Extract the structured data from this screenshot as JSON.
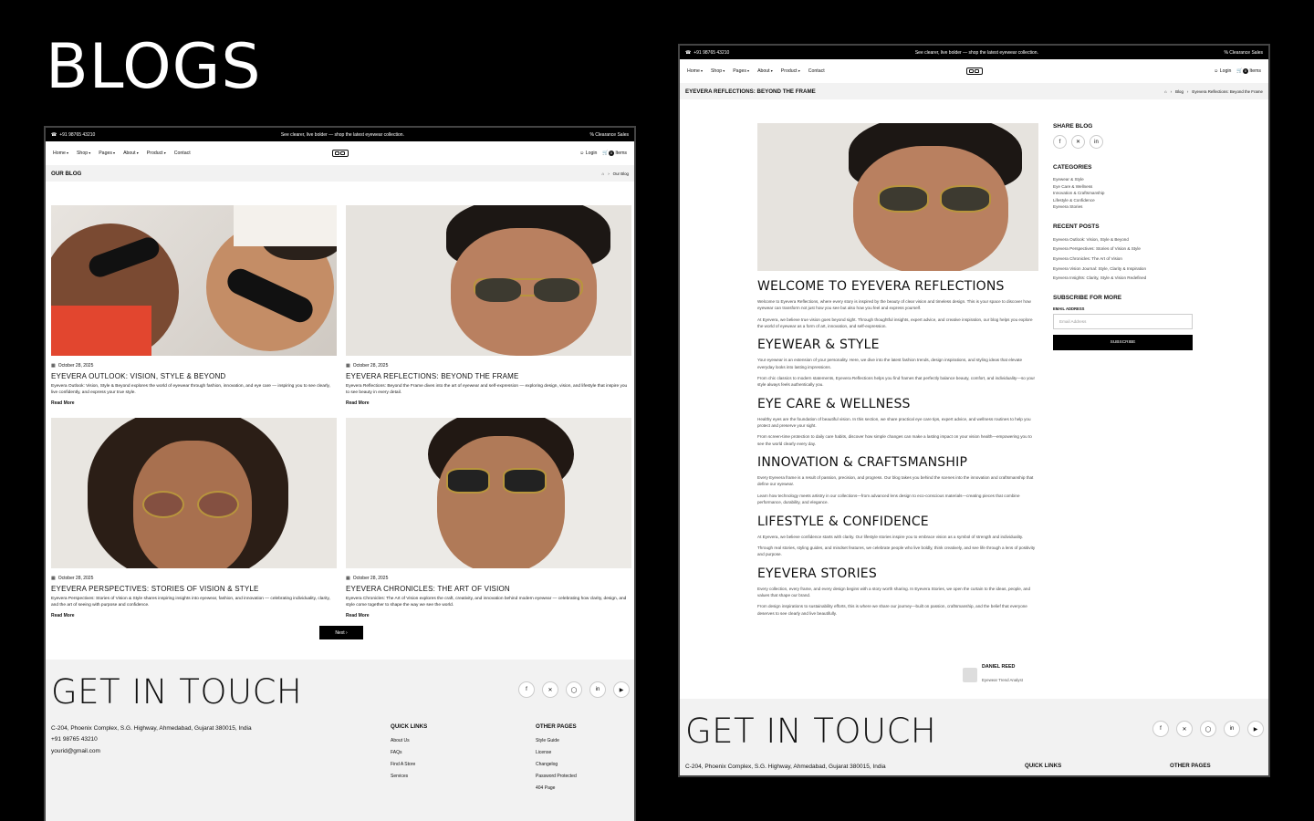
{
  "heading": "BLOGS",
  "topbar": {
    "phone": "+91 98765 43210",
    "promo": "See clearer, live bolder — shop the latest eyewear collection.",
    "sale": "Clearance Sales"
  },
  "nav": {
    "items": [
      "Home",
      "Shop",
      "Pages",
      "About",
      "Product",
      "Contact"
    ],
    "login": "Login",
    "cart_count": "0",
    "cart_label": "Items"
  },
  "blog_page": {
    "title": "OUR BLOG",
    "crumb": "Our Blog",
    "posts": [
      {
        "date": "October 28, 2025",
        "title": "EYEVERA OUTLOOK: VISION, STYLE & BEYOND",
        "excerpt": "Eyevera Outlook: Vision, Style & Beyond explores the world of eyewear through fashion, innovation, and eye care — inspiring you to see clearly, live confidently, and express your true style.",
        "read_more": "Read More"
      },
      {
        "date": "October 28, 2025",
        "title": "EYEVERA REFLECTIONS: BEYOND THE FRAME",
        "excerpt": "Eyevera Reflections: Beyond the Frame dives into the art of eyewear and self-expression — exploring design, vision, and lifestyle that inspire you to see beauty in every detail.",
        "read_more": "Read More"
      },
      {
        "date": "October 28, 2025",
        "title": "EYEVERA PERSPECTIVES: STORIES OF VISION & STYLE",
        "excerpt": "Eyevera Perspectives: Stories of Vision & Style shares inspiring insights into eyewear, fashion, and innovation — celebrating individuality, clarity, and the art of seeing with purpose and confidence.",
        "read_more": "Read More"
      },
      {
        "date": "October 28, 2025",
        "title": "EYEVERA CHRONICLES: THE ART OF VISION",
        "excerpt": "Eyevera Chronicles: The Art of Vision explores the craft, creativity, and innovation behind modern eyewear — celebrating how clarity, design, and style come together to shape the way we see the world.",
        "read_more": "Read More"
      }
    ],
    "next": "Next"
  },
  "footer": {
    "heading": "GET IN TOUCH",
    "address": "C-204, Phoenix Complex, S.G. Highway, Ahmedabad, Gujarat 380015, India",
    "phone": "+91 98765 43210",
    "email": "yourid@gmail.com",
    "quick_links_title": "QUICK LINKS",
    "quick_links": [
      "About Us",
      "FAQs",
      "Find A Store",
      "Services"
    ],
    "other_pages_title": "OTHER PAGES",
    "other_pages": [
      "Style Guide",
      "License",
      "Changelog",
      "Password Protected",
      "404 Page"
    ]
  },
  "article_page": {
    "title": "EYEVERA REFLECTIONS: BEYOND THE FRAME",
    "crumb_blog": "Blog",
    "crumb_current": "Eyevera Reflections: Beyond the Frame",
    "sections": [
      {
        "h": "WELCOME TO EYEVERA REFLECTIONS",
        "p1": "Welcome to Eyevera Reflections, where every story is inspired by the beauty of clear vision and timeless design. This is your space to discover how eyewear can transform not just how you see but also how you feel and express yourself.",
        "p2": "At Eyevera, we believe true vision goes beyond sight. Through thoughtful insights, expert advice, and creative inspiration, our blog helps you explore the world of eyewear as a form of art, innovation, and self-expression."
      },
      {
        "h": "EYEWEAR & STYLE",
        "p1": "Your eyewear is an extension of your personality. Here, we dive into the latest fashion trends, design inspirations, and styling ideas that elevate everyday looks into lasting impressions.",
        "p2": "From chic classics to modern statements, Eyevera Reflections helps you find frames that perfectly balance beauty, comfort, and individuality—so your style always feels authentically you."
      },
      {
        "h": "EYE CARE & WELLNESS",
        "p1": "Healthy eyes are the foundation of beautiful vision. In this section, we share practical eye care tips, expert advice, and wellness routines to help you protect and preserve your sight.",
        "p2": "From screen-time protection to daily care habits, discover how simple changes can make a lasting impact on your vision health—empowering you to see the world clearly every day."
      },
      {
        "h": "INNOVATION & CRAFTSMANSHIP",
        "p1": "Every Eyevera frame is a result of passion, precision, and progress. Our blog takes you behind the scenes into the innovation and craftsmanship that define our eyewear.",
        "p2": "Learn how technology meets artistry in our collections—from advanced lens design to eco-conscious materials—creating pieces that combine performance, durability, and elegance."
      },
      {
        "h": "LIFESTYLE & CONFIDENCE",
        "p1": "At Eyevera, we believe confidence starts with clarity. Our lifestyle stories inspire you to embrace vision as a symbol of strength and individuality.",
        "p2": "Through real stories, styling guides, and mindset features, we celebrate people who live boldly, think creatively, and see life through a lens of positivity and purpose."
      },
      {
        "h": "EYEVERA STORIES",
        "p1": "Every collection, every frame, and every design begins with a story worth sharing. In Eyevera Stories, we open the curtain to the ideas, people, and values that shape our brand.",
        "p2": "From design inspirations to sustainability efforts, this is where we share our journey—built on passion, craftsmanship, and the belief that everyone deserves to see clearly and live beautifully."
      }
    ],
    "author": {
      "name": "DANIEL REED",
      "role": "Eyewear Trend Analyst"
    },
    "sidebar": {
      "share_title": "SHARE BLOG",
      "categories_title": "CATEGORIES",
      "categories": [
        "Eyewear & Style",
        "Eye Care & Wellness",
        "Innovation & Craftsmanship",
        "Lifestyle & Confidence",
        "Eyevera Stories"
      ],
      "recent_title": "RECENT POSTS",
      "recent": [
        "Eyevera Outlook: Vision, Style & Beyond",
        "Eyevera Perspectives: Stories of Vision & Style",
        "Eyevera Chronicles: The Art of Vision",
        "Eyevera Vision Journal: Style, Clarity & Inspiration",
        "Eyevera Insights: Clarity, Style & Vision Redefined"
      ],
      "subscribe_title": "SUBSCRIBE FOR MORE",
      "email_label": "EMAIL ADDRESS",
      "email_placeholder": "Email Address",
      "subscribe_btn": "SUBSCRIBE"
    }
  }
}
